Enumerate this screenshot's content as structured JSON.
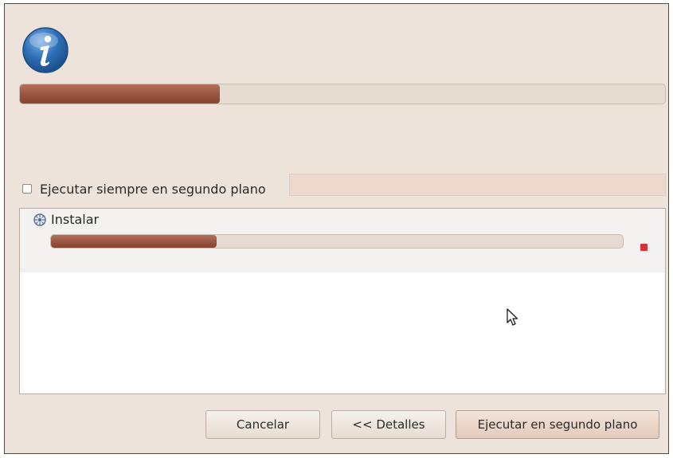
{
  "dialog": {
    "icon": "info-icon",
    "overall_progress_percent": 31
  },
  "options": {
    "run_in_background_label": "Ejecutar siempre en segundo plano",
    "run_in_background_checked": false
  },
  "jobs": [
    {
      "label": "Instalar",
      "icon": "install-job-icon",
      "progress_percent": 29,
      "stop_icon": "stop-icon",
      "stop_color": "#d5323a"
    }
  ],
  "buttons": {
    "cancel_label": "Cancelar",
    "details_label": "<< Detalles",
    "run_background_label": "Ejecutar en segundo plano"
  },
  "colors": {
    "progress_fill": "#9a5640",
    "info_blue": "#2d6fb7",
    "dialog_bg": "#ede3da"
  }
}
